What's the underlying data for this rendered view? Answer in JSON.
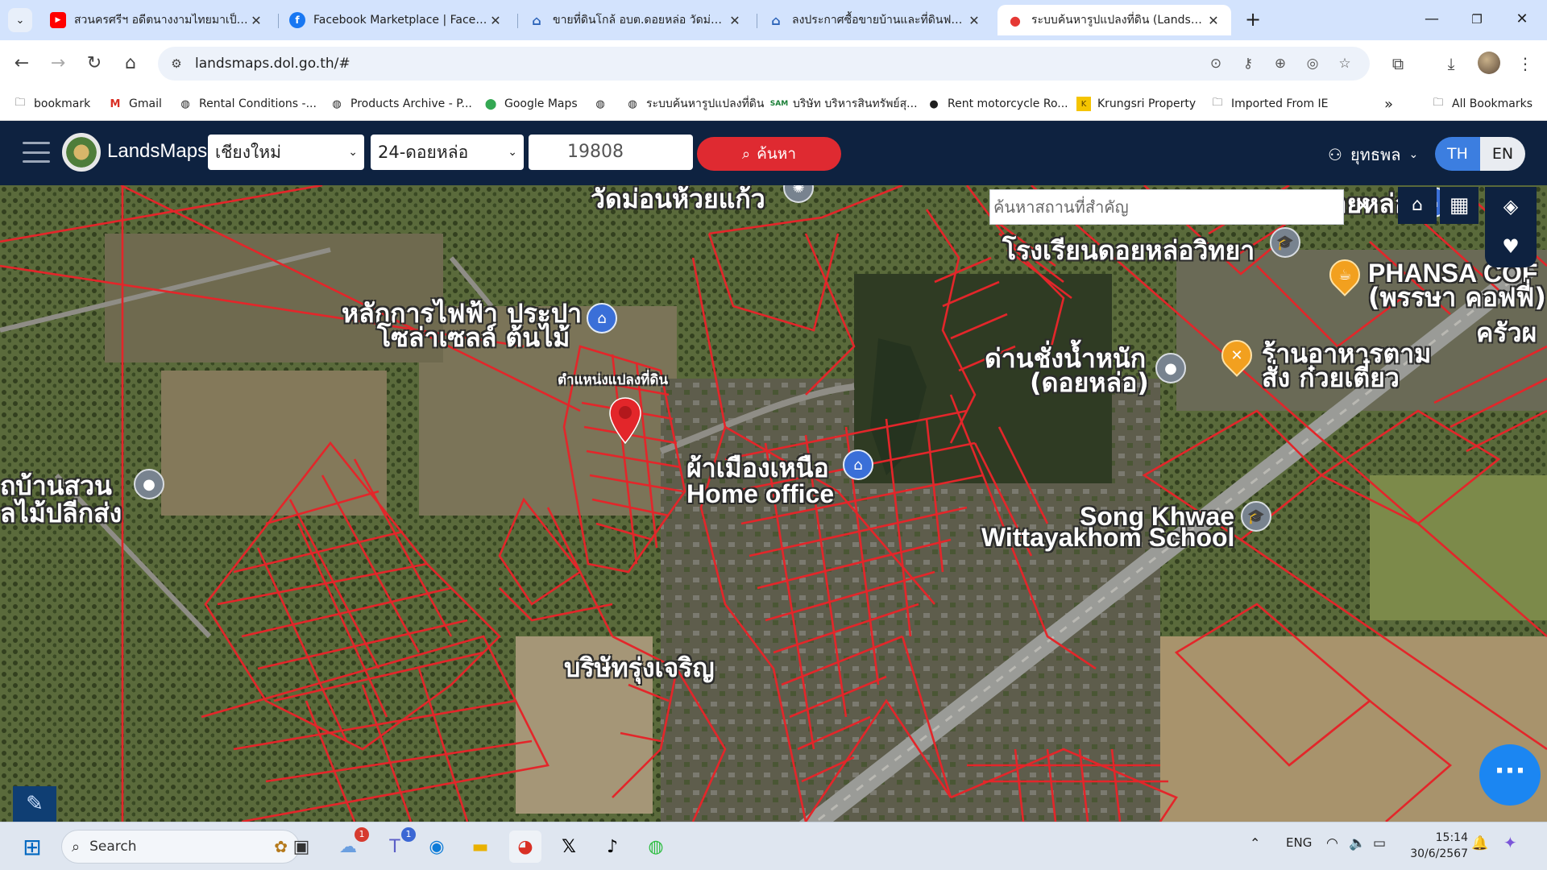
{
  "browser": {
    "tabs": [
      {
        "title": "สวนครศรีฯ อดีตนางงามไทยมาเป็นแ",
        "icon": "youtube-icon",
        "active": false
      },
      {
        "title": "Facebook Marketplace | Facebo",
        "icon": "facebook-icon",
        "active": false
      },
      {
        "title": "ขายที่ดินโกล้ อบต.ดอยหล่อ วัดม่อนห้",
        "icon": "house-icon",
        "active": false
      },
      {
        "title": "ลงประกาศซื้อขายบ้านและที่ดินฟรี! | ส",
        "icon": "house-icon",
        "active": false
      },
      {
        "title": "ระบบค้นหารูปแปลงที่ดิน (LandsMap",
        "icon": "map-pin-icon",
        "active": true
      }
    ],
    "url": "landsmaps.dol.go.th/#",
    "bookmarks": [
      {
        "label": "bookmark",
        "icon": "folder-icon"
      },
      {
        "label": "Gmail",
        "icon": "gmail-icon"
      },
      {
        "label": "Rental Conditions -...",
        "icon": "globe-icon"
      },
      {
        "label": "Products Archive - P...",
        "icon": "globe-icon"
      },
      {
        "label": "Google Maps",
        "icon": "google-maps-icon"
      },
      {
        "label": "",
        "icon": "globe-icon"
      },
      {
        "label": "ระบบค้นหารูปแปลงที่ดิน",
        "icon": "globe-icon"
      },
      {
        "label": "บริษัท บริหารสินทรัพย์สุ...",
        "icon": "sam-icon"
      },
      {
        "label": "Rent motorcycle Ro...",
        "icon": "motorcycle-icon"
      },
      {
        "label": "Krungsri Property",
        "icon": "krungsri-icon"
      },
      {
        "label": "Imported From IE",
        "icon": "folder-icon"
      }
    ],
    "overflow_label": "»",
    "all_bookmarks": "All Bookmarks"
  },
  "app": {
    "brand": "LandsMaps",
    "province": "เชียงใหม่",
    "district": "24-ดอยหล่อ",
    "parcel_no": "19808",
    "search_label": "ค้นหา",
    "user_name": "ยุทธพล",
    "lang_th": "TH",
    "lang_en": "EN",
    "place_search_placeholder": "ค้นหาสถานที่สำคัญ",
    "accent_red": "#df2a31",
    "header_navy": "#0e2240"
  },
  "map": {
    "pin_label": "ตำแหน่งแปลงที่ดิน",
    "labels": [
      {
        "id": "wat",
        "text": "วัดม่อนห้วยแก้ว"
      },
      {
        "id": "market",
        "text": "ตลาดสดดอยหล่อ"
      },
      {
        "id": "school_th",
        "text": "โรงเรียนดอยหล่อวิทยา"
      },
      {
        "id": "phansa1",
        "text": "PHANSA COF"
      },
      {
        "id": "phansa2",
        "text": "(พรรษา คอฟฟี่)"
      },
      {
        "id": "krua",
        "text": "ครัวผ"
      },
      {
        "id": "solar1",
        "text": "หลักการไฟฟ้า ประปา"
      },
      {
        "id": "solar2",
        "text": "โซล่าเซลล์ ต้นไม้"
      },
      {
        "id": "weigh1",
        "text": "ด่านชั่งน้ำหนัก"
      },
      {
        "id": "weigh2",
        "text": "(ดอยหล่อ)"
      },
      {
        "id": "food1",
        "text": "ร้านอาหารตาม"
      },
      {
        "id": "food2",
        "text": "สั่ง ก๋วยเตี๋ยว"
      },
      {
        "id": "office1",
        "text": "ผ้าเมืองเหนือ"
      },
      {
        "id": "office2",
        "text": "Home office"
      },
      {
        "id": "garden1",
        "text": "ถบ้านสวน"
      },
      {
        "id": "garden2",
        "text": "ลไม้ปลีกส่ง"
      },
      {
        "id": "song1",
        "text": "Song Khwae"
      },
      {
        "id": "song2",
        "text": "Wittayakhom School"
      },
      {
        "id": "bottom",
        "text": "บริษัทรุ่งเจริญ"
      }
    ]
  },
  "taskbar": {
    "search_label": "Search",
    "apps": [
      {
        "name": "task-view",
        "icon": "task-view-icon"
      },
      {
        "name": "weather",
        "icon": "weather-icon",
        "badge": "1"
      },
      {
        "name": "teams",
        "icon": "teams-icon",
        "badge": "1"
      },
      {
        "name": "edge",
        "icon": "edge-icon"
      },
      {
        "name": "explorer",
        "icon": "folder-icon"
      },
      {
        "name": "chrome",
        "icon": "chrome-icon"
      },
      {
        "name": "x",
        "icon": "x-icon"
      },
      {
        "name": "tiktok",
        "icon": "tiktok-icon"
      },
      {
        "name": "wechat",
        "icon": "wechat-icon"
      }
    ],
    "lang": "ENG",
    "time": "15:14",
    "date": "30/6/2567"
  }
}
